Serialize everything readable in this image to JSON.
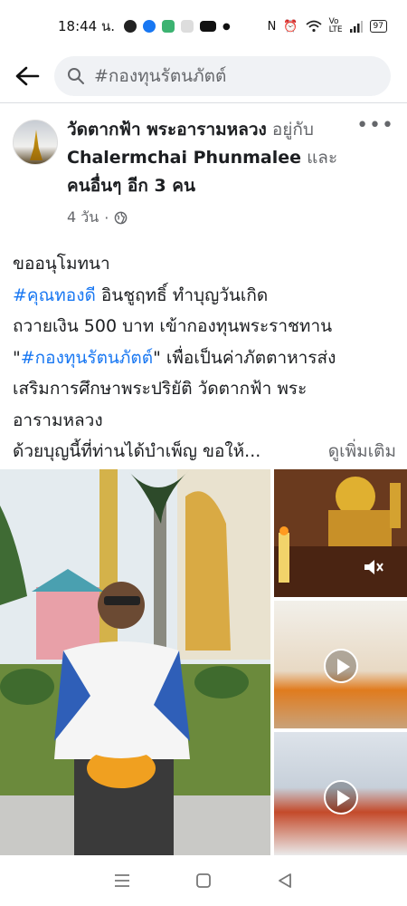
{
  "status_bar": {
    "time": "18:44 น.",
    "battery": "97",
    "icons": [
      "line-icon",
      "messenger-icon",
      "app-icon",
      "tiktok-icon",
      "youtube-icon",
      "dot-icon",
      "nfc-icon",
      "alarm-icon",
      "wifi-icon",
      "volte-icon",
      "signal-icon",
      "battery-icon"
    ]
  },
  "search": {
    "query": "#กองทุนรัตนภัตต์"
  },
  "post": {
    "author": "วัดตากฟ้า พระอารามหลวง",
    "with_text": "อยู่กับ",
    "tagged": "Chalermchai Phunmalee",
    "and_text": "และ",
    "others": "คนอื่นๆ อีก 3 คน",
    "time": "4 วัน",
    "lines": {
      "l1": "ขออนุโมทนา",
      "l2_tag": "#คุณทองดี",
      "l2_rest": " อินชูฤทธิ์ ทำบุญวันเกิด",
      "l3": "ถวายเงิน 500 บาท เข้ากองทุนพระราชทาน",
      "l4_open": "\"",
      "l4_tag": "#กองทุนรัตนภัตต์",
      "l4_rest": "\"  เพื่อเป็นค่าภัตตาหารส่ง",
      "l5": "เสริมการศึกษาพระปริยัติ วัดตากฟ้า พระ",
      "l6": "อารามหลวง",
      "l7": " ด้วยบุญนี้ที่ท่านได้บำเพ็ญ ขอให้...",
      "see_more": "ดูเพิ่มเติม"
    }
  },
  "photos": [
    {
      "kind": "photo",
      "subject": "man-holding-garland"
    },
    {
      "kind": "photo",
      "subject": "buddha-altar"
    },
    {
      "kind": "video",
      "subject": "monks-hall"
    },
    {
      "kind": "video",
      "subject": "monks-seated"
    }
  ],
  "colors": {
    "link": "#1877f2",
    "muted": "#65676b",
    "text": "#1c1e21",
    "search_bg": "#f0f2f5"
  }
}
